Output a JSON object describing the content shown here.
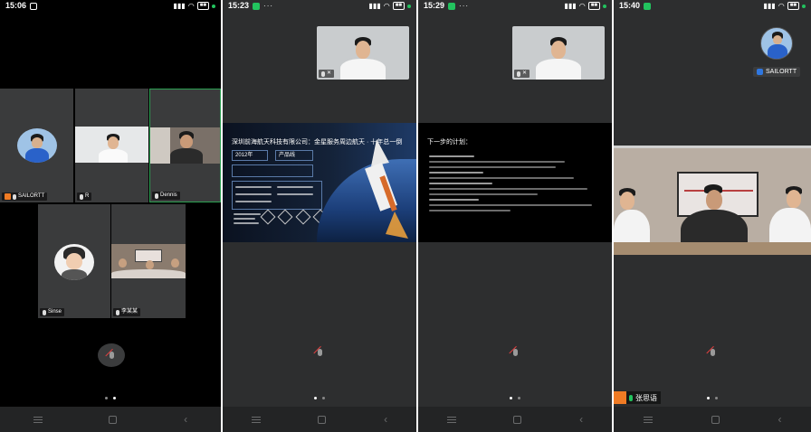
{
  "phone1": {
    "status_time": "15:06",
    "tiles": [
      {
        "label": "SAILORTT"
      },
      {
        "label": "R"
      },
      {
        "label": "Dennis"
      },
      {
        "label": "Sinse"
      },
      {
        "label": "李某某"
      }
    ]
  },
  "phone2": {
    "status_time": "15:23",
    "slide_title": "深圳前海航天科技有限公司：金星服务周边航天 · 十年总一倒",
    "slide_stat1": "2012年",
    "slide_stat2": "产品线"
  },
  "phone3": {
    "status_time": "15:29",
    "slide_title": "下一步的计划："
  },
  "phone4": {
    "status_time": "15:40",
    "top_user": "SAILORTT",
    "bottom_user": "张思语"
  },
  "colors": {
    "accent_green": "#22c35e",
    "orange_host": "#f07b24",
    "user_blue": "#2f77e0",
    "screen_bg": "#2d2e2f"
  }
}
